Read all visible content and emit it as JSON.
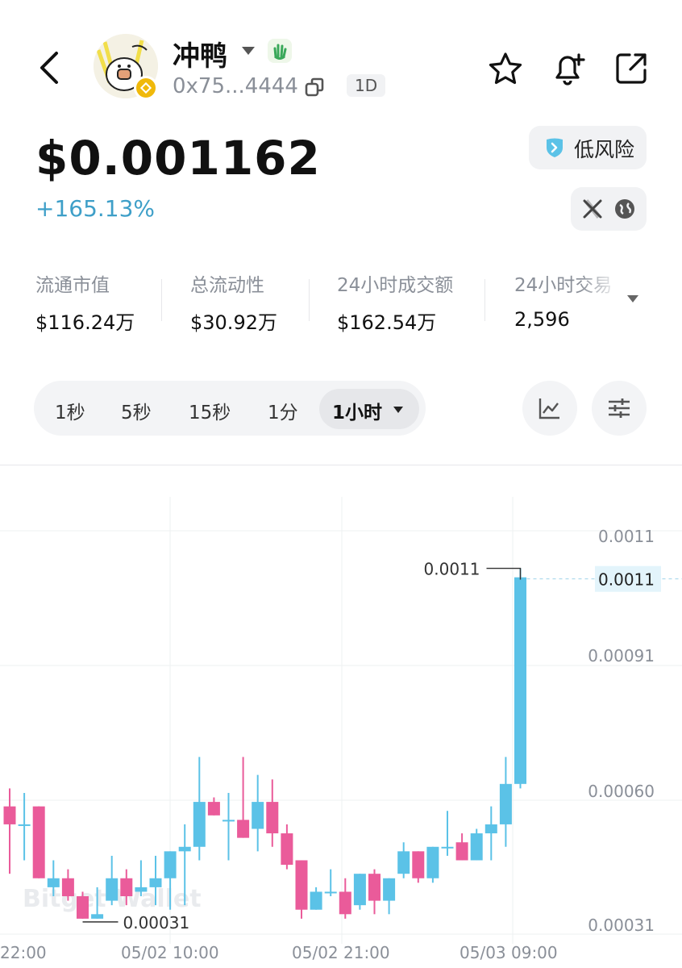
{
  "header": {
    "token_name": "冲鸭",
    "address": "0x75...4444",
    "age_badge": "1D",
    "icons": {
      "back": "chevron-left-icon",
      "copy": "copy-icon",
      "favorite": "star-icon",
      "alert": "bell-plus-icon",
      "share": "share-icon"
    }
  },
  "price": {
    "value": "$0.001162",
    "change": "+165.13%",
    "risk_label": "低风险",
    "colors": {
      "change": "#3e9fc8",
      "up": "#5bc2e7",
      "down": "#ea5b9a"
    }
  },
  "stats": [
    {
      "label": "流通市值",
      "value": "$116.24万"
    },
    {
      "label": "总流动性",
      "value": "$30.92万"
    },
    {
      "label": "24小时成交额",
      "value": "$162.54万"
    },
    {
      "label": "24小时交易",
      "value": "2,596"
    }
  ],
  "intervals": {
    "items": [
      "1秒",
      "5秒",
      "15秒",
      "1分"
    ],
    "selected": "1小时"
  },
  "chart_data": {
    "type": "candlestick",
    "x_tick_labels": [
      "22:00",
      "05/02 10:00",
      "05/02 21:00",
      "05/03 09:00"
    ],
    "y_tick_labels": [
      "0.0011",
      "0.00091",
      "0.00060",
      "0.00031"
    ],
    "ylim": [
      0.00028,
      0.00116
    ],
    "current_price_label": "0.0011",
    "high_marker_label": "0.0011",
    "low_marker_label": "0.00031",
    "watermark": "Bitget Wallet",
    "candles": [
      {
        "o": 0.00055,
        "c": 0.00051,
        "h": 0.00059,
        "l": 0.0004
      },
      {
        "o": 0.00051,
        "c": 0.00051,
        "h": 0.00058,
        "l": 0.00043
      },
      {
        "o": 0.00055,
        "c": 0.00039,
        "h": 0.00055,
        "l": 0.00039
      },
      {
        "o": 0.00037,
        "c": 0.00039,
        "h": 0.00043,
        "l": 0.00035
      },
      {
        "o": 0.00039,
        "c": 0.00035,
        "h": 0.00041,
        "l": 0.00034
      },
      {
        "o": 0.00035,
        "c": 0.0003,
        "h": 0.00036,
        "l": 0.0003
      },
      {
        "o": 0.0003,
        "c": 0.00031,
        "h": 0.00037,
        "l": 0.0003
      },
      {
        "o": 0.00034,
        "c": 0.00039,
        "h": 0.00044,
        "l": 0.00033
      },
      {
        "o": 0.00039,
        "c": 0.00035,
        "h": 0.00041,
        "l": 0.00033
      },
      {
        "o": 0.00036,
        "c": 0.00037,
        "h": 0.00043,
        "l": 0.00035
      },
      {
        "o": 0.00037,
        "c": 0.00039,
        "h": 0.00044,
        "l": 0.00033
      },
      {
        "o": 0.00039,
        "c": 0.00045,
        "h": 0.00045,
        "l": 0.00032
      },
      {
        "o": 0.00045,
        "c": 0.00046,
        "h": 0.00051,
        "l": 0.00033
      },
      {
        "o": 0.00046,
        "c": 0.00056,
        "h": 0.00066,
        "l": 0.00043
      },
      {
        "o": 0.00056,
        "c": 0.00053,
        "h": 0.00057,
        "l": 0.00053
      },
      {
        "o": 0.00052,
        "c": 0.00052,
        "h": 0.00058,
        "l": 0.00043
      },
      {
        "o": 0.00052,
        "c": 0.00048,
        "h": 0.00066,
        "l": 0.00048
      },
      {
        "o": 0.0005,
        "c": 0.00056,
        "h": 0.00062,
        "l": 0.00045
      },
      {
        "o": 0.00056,
        "c": 0.00049,
        "h": 0.00061,
        "l": 0.00046
      },
      {
        "o": 0.00049,
        "c": 0.00042,
        "h": 0.00051,
        "l": 0.00041
      },
      {
        "o": 0.00043,
        "c": 0.00032,
        "h": 0.00043,
        "l": 0.0003
      },
      {
        "o": 0.00032,
        "c": 0.00036,
        "h": 0.00037,
        "l": 0.00032
      },
      {
        "o": 0.00036,
        "c": 0.00036,
        "h": 0.00041,
        "l": 0.00035
      },
      {
        "o": 0.00036,
        "c": 0.00031,
        "h": 0.00039,
        "l": 0.0003
      },
      {
        "o": 0.00033,
        "c": 0.0004,
        "h": 0.0004,
        "l": 0.00032
      },
      {
        "o": 0.0004,
        "c": 0.00034,
        "h": 0.00041,
        "l": 0.00031
      },
      {
        "o": 0.00034,
        "c": 0.00039,
        "h": 0.00039,
        "l": 0.00031
      },
      {
        "o": 0.0004,
        "c": 0.00045,
        "h": 0.00047,
        "l": 0.00039
      },
      {
        "o": 0.00045,
        "c": 0.00039,
        "h": 0.00045,
        "l": 0.00038
      },
      {
        "o": 0.00039,
        "c": 0.00046,
        "h": 0.00046,
        "l": 0.00038
      },
      {
        "o": 0.00046,
        "c": 0.00046,
        "h": 0.00054,
        "l": 0.00044
      },
      {
        "o": 0.00047,
        "c": 0.00043,
        "h": 0.00049,
        "l": 0.00043
      },
      {
        "o": 0.00043,
        "c": 0.00049,
        "h": 0.0005,
        "l": 0.00043
      },
      {
        "o": 0.00049,
        "c": 0.00051,
        "h": 0.00055,
        "l": 0.00043
      },
      {
        "o": 0.00051,
        "c": 0.0006,
        "h": 0.00066,
        "l": 0.00046
      },
      {
        "o": 0.0006,
        "c": 0.00106,
        "h": 0.00108,
        "l": 0.00059
      }
    ]
  }
}
